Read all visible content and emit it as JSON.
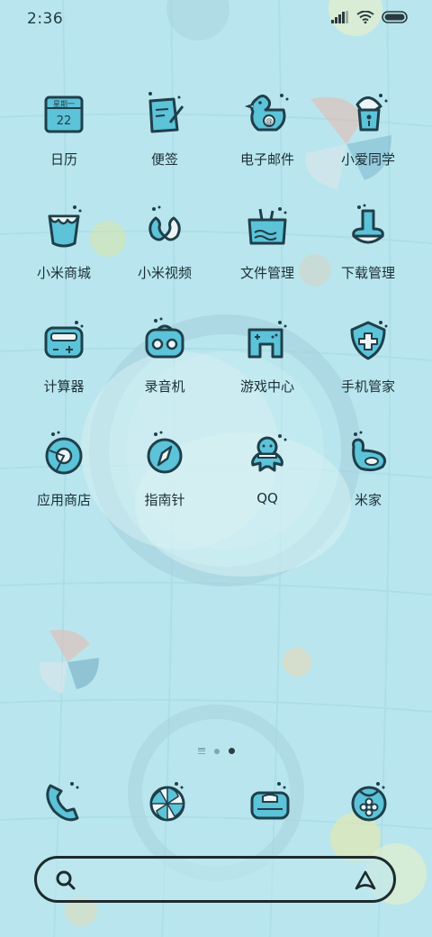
{
  "status_bar": {
    "time": "2:36"
  },
  "apps": [
    {
      "label": "日历",
      "icon": "calendar-icon",
      "calendar_weekday": "星期一",
      "calendar_day": "22"
    },
    {
      "label": "便签",
      "icon": "notes-icon"
    },
    {
      "label": "电子邮件",
      "icon": "email-duck-icon"
    },
    {
      "label": "小爱同学",
      "icon": "assistant-icon"
    },
    {
      "label": "小米商城",
      "icon": "store-icon"
    },
    {
      "label": "小米视频",
      "icon": "video-icon"
    },
    {
      "label": "文件管理",
      "icon": "files-icon"
    },
    {
      "label": "下载管理",
      "icon": "download-icon"
    },
    {
      "label": "计算器",
      "icon": "calculator-icon"
    },
    {
      "label": "录音机",
      "icon": "recorder-icon"
    },
    {
      "label": "游戏中心",
      "icon": "game-icon"
    },
    {
      "label": "手机管家",
      "icon": "security-icon"
    },
    {
      "label": "应用商店",
      "icon": "app-store-icon"
    },
    {
      "label": "指南针",
      "icon": "compass-icon"
    },
    {
      "label": "QQ",
      "icon": "qq-icon"
    },
    {
      "label": "米家",
      "icon": "mi-home-icon"
    }
  ],
  "dock": [
    {
      "icon": "phone-icon"
    },
    {
      "icon": "browser-icon"
    },
    {
      "icon": "messages-icon"
    },
    {
      "icon": "camera-icon"
    }
  ],
  "page_indicator": {
    "pages": 2,
    "current": 2
  },
  "colors": {
    "background": "#b9e6ee",
    "icon_fill": "#5cc3d8",
    "icon_stroke": "#1f3f4a"
  }
}
